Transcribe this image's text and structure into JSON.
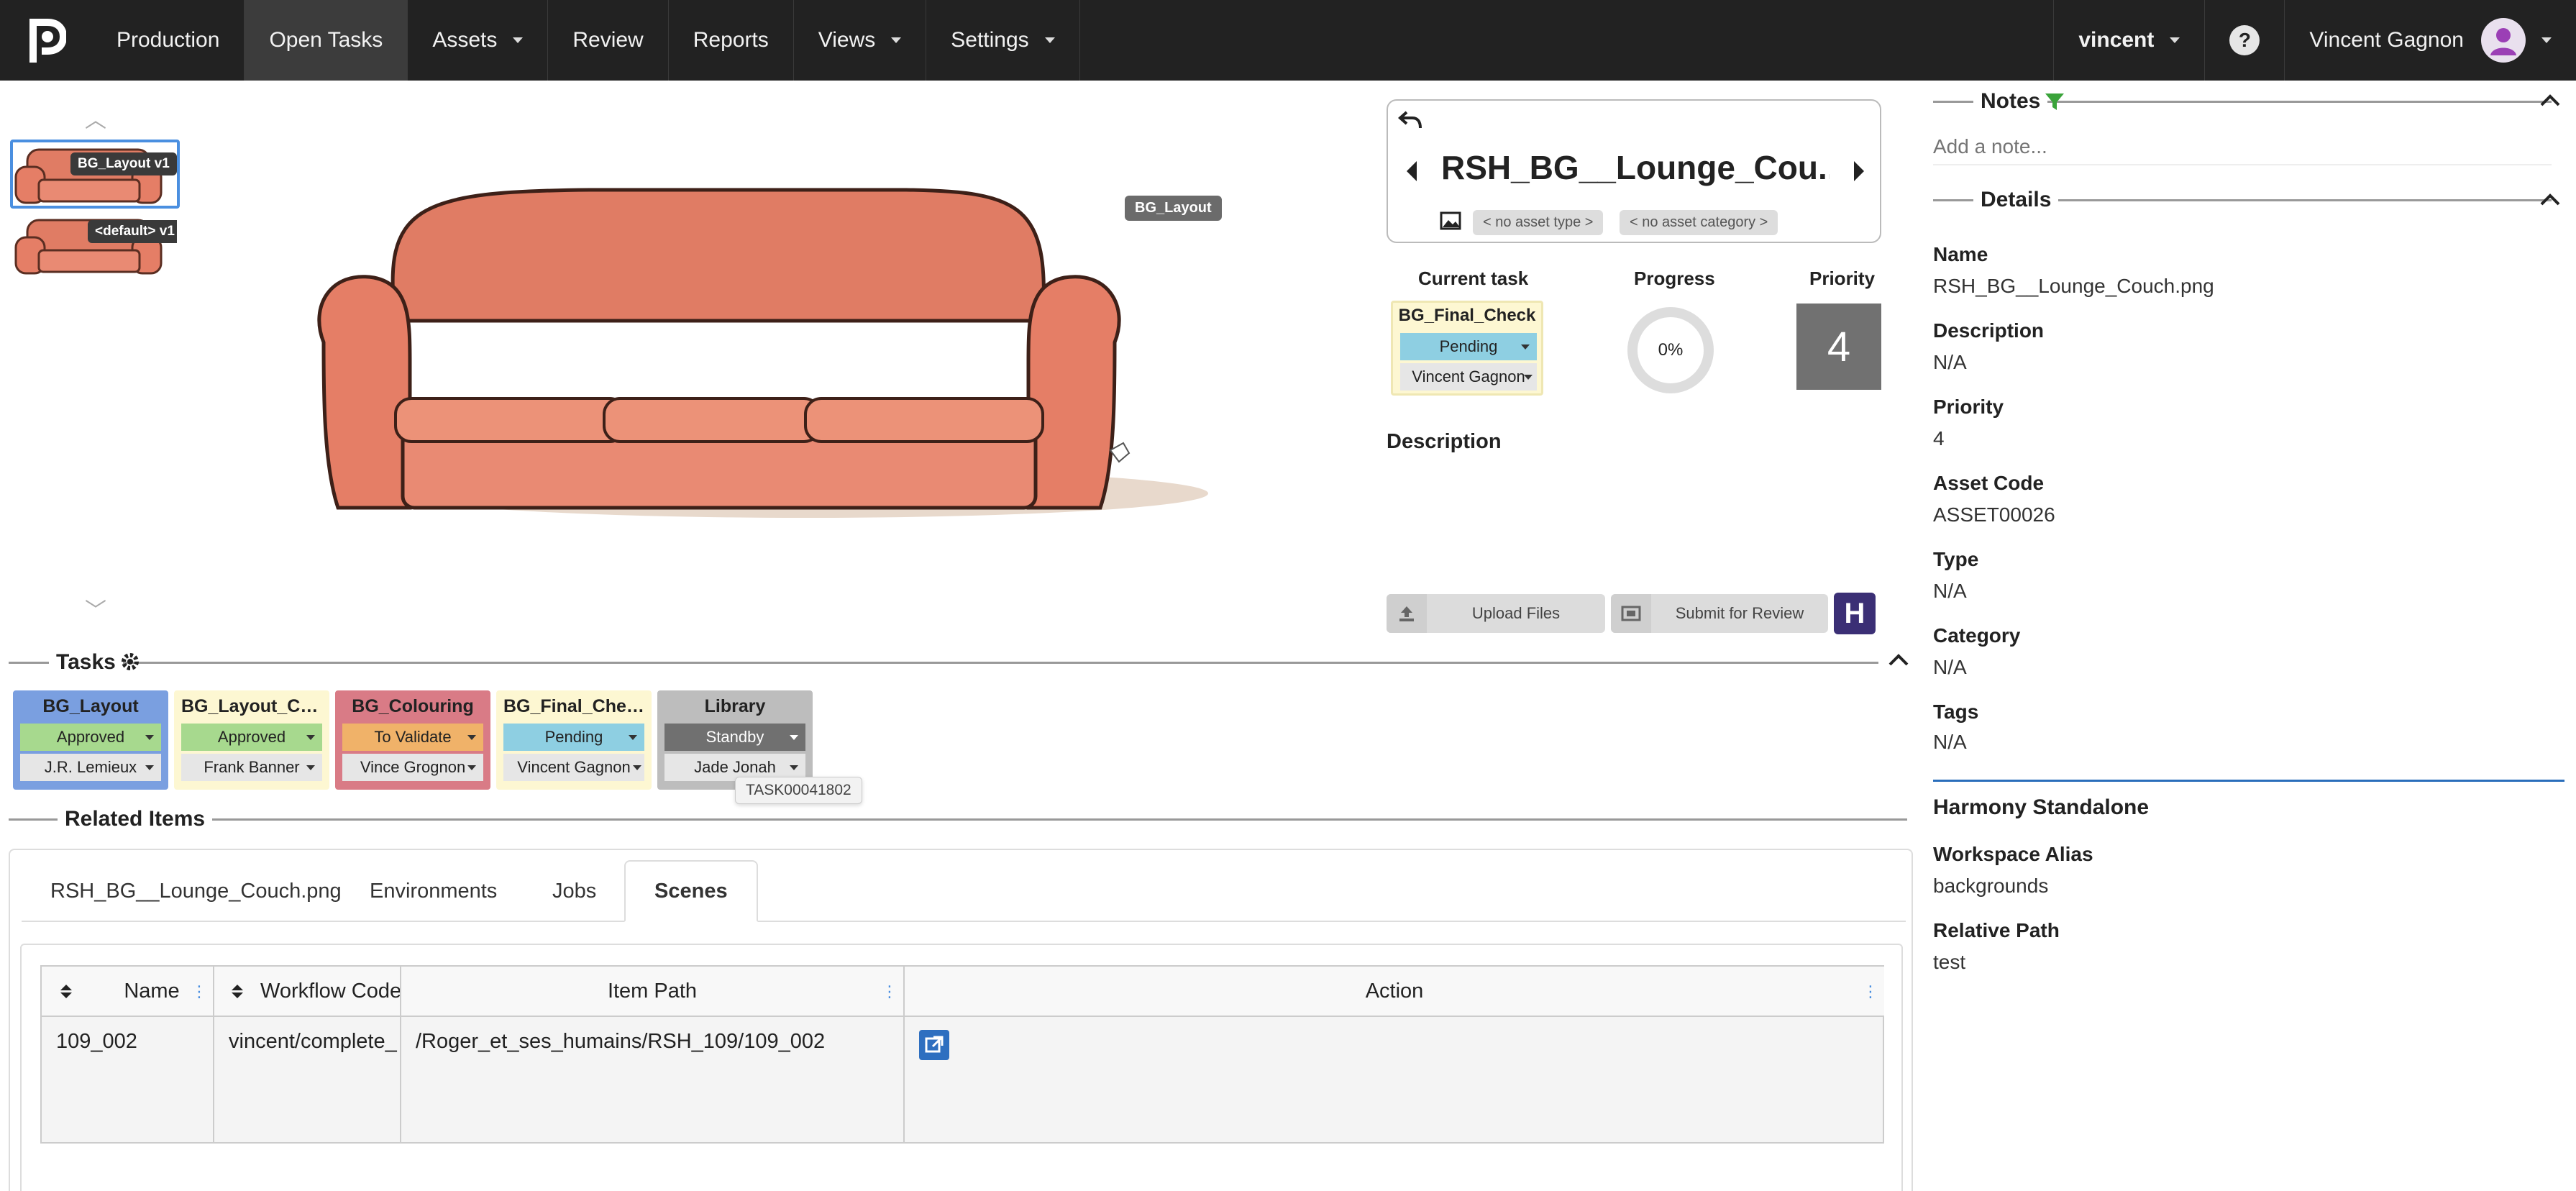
{
  "nav": {
    "items": [
      {
        "label": "Production",
        "dropdown": false
      },
      {
        "label": "Open Tasks",
        "dropdown": false,
        "active": true
      },
      {
        "label": "Assets",
        "dropdown": true
      },
      {
        "label": "Review",
        "dropdown": false
      },
      {
        "label": "Reports",
        "dropdown": false
      },
      {
        "label": "Views",
        "dropdown": true
      },
      {
        "label": "Settings",
        "dropdown": true
      }
    ],
    "user_short": "vincent",
    "help": "?",
    "user_full": "Vincent Gagnon"
  },
  "thumbnails": [
    {
      "label": "BG_Layout v1",
      "selected": true
    },
    {
      "label": "<default> v1",
      "selected": false
    }
  ],
  "preview": {
    "tag": "BG_Layout"
  },
  "asset": {
    "title": "RSH_BG__Lounge_Cou...",
    "type_chip": "< no asset type >",
    "category_chip": "< no asset category >"
  },
  "current_task": {
    "label": "Current task",
    "name": "BG_Final_Check",
    "status": "Pending",
    "assignee": "Vincent Gagnon"
  },
  "progress": {
    "label": "Progress",
    "value": 0,
    "text": "0%"
  },
  "priority": {
    "label": "Priority",
    "value": "4"
  },
  "description": {
    "label": "Description"
  },
  "buttons": {
    "upload": "Upload Files",
    "submit": "Submit for Review",
    "harmony": "H"
  },
  "tasks_section": {
    "title": "Tasks"
  },
  "tasks": [
    {
      "name": "BG_Layout",
      "status": "Approved",
      "assignee": "J.R. Lemieux"
    },
    {
      "name": "BG_Layout_Ch...",
      "status": "Approved",
      "assignee": "Frank Banner"
    },
    {
      "name": "BG_Colouring",
      "status": "To Validate",
      "assignee": "Vince Grognon"
    },
    {
      "name": "BG_Final_Check",
      "status": "Pending",
      "assignee": "Vincent Gagnon"
    },
    {
      "name": "Library",
      "status": "Standby",
      "assignee": "Jade Jonah"
    }
  ],
  "tooltip": "TASK00041802",
  "related": {
    "title": "Related Items",
    "tabs": [
      "RSH_BG__Lounge_Couch.png",
      "Environments",
      "Jobs",
      "Scenes"
    ],
    "active_tab": 3,
    "columns": [
      "Name",
      "Workflow Code",
      "Item Path",
      "Action"
    ],
    "rows": [
      {
        "name": "109_002",
        "workflow": "vincent/complete_",
        "path": "/Roger_et_ses_humains/RSH_109/109_002"
      }
    ]
  },
  "notes": {
    "title": "Notes",
    "placeholder": "Add a note..."
  },
  "details": {
    "title": "Details",
    "fields": [
      {
        "label": "Name",
        "value": "RSH_BG__Lounge_Couch.png"
      },
      {
        "label": "Description",
        "value": "N/A"
      },
      {
        "label": "Priority",
        "value": "4"
      },
      {
        "label": "Asset Code",
        "value": "ASSET00026"
      },
      {
        "label": "Type",
        "value": "N/A"
      },
      {
        "label": "Category",
        "value": "N/A"
      },
      {
        "label": "Tags",
        "value": "N/A"
      }
    ]
  },
  "harmony": {
    "title": "Harmony Standalone",
    "fields": [
      {
        "label": "Workspace Alias",
        "value": "backgrounds"
      },
      {
        "label": "Relative Path",
        "value": "test"
      }
    ]
  },
  "colors": {
    "navbar": "#222222",
    "approved": "#a7d98e",
    "pending": "#8ecfe2",
    "to_validate": "#f0b269",
    "standby": "#707070",
    "accent_blue": "#2a6ebb"
  }
}
